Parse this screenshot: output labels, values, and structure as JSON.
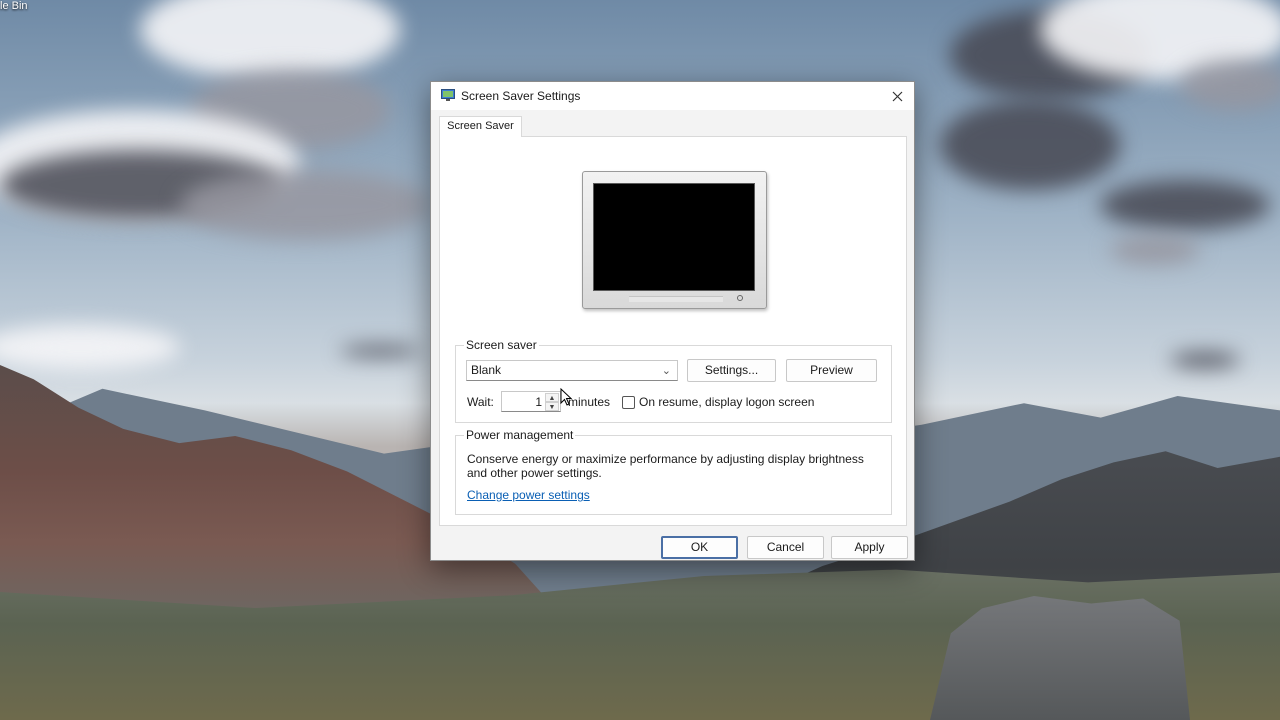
{
  "desktop": {
    "recycle_bin_label": "le Bin"
  },
  "dialog": {
    "title": "Screen Saver Settings",
    "tab_label": "Screen Saver",
    "screen_saver": {
      "group_label": "Screen saver",
      "selected": "Blank",
      "settings_label": "Settings...",
      "preview_label": "Preview",
      "wait_label": "Wait:",
      "wait_value": "1",
      "minutes_label": "minutes",
      "on_resume_label": "On resume, display logon screen",
      "on_resume_checked": false
    },
    "power": {
      "group_label": "Power management",
      "description": "Conserve energy or maximize performance by adjusting display brightness and other power settings.",
      "link": "Change power settings"
    },
    "buttons": {
      "ok": "OK",
      "cancel": "Cancel",
      "apply": "Apply"
    }
  },
  "icons": {
    "title": "display-settings-icon",
    "close": "close-icon",
    "dropdown": "chevron-down-icon",
    "spin_up": "arrow-up-icon",
    "spin_down": "arrow-down-icon",
    "cursor": "mouse-cursor-icon"
  },
  "colors": {
    "link": "#0a5fb4",
    "dialog_bg": "#f3f3f3",
    "panel_bg": "#ffffff",
    "preview_screen": "#000000",
    "ok_border": "#4a6fa5"
  }
}
